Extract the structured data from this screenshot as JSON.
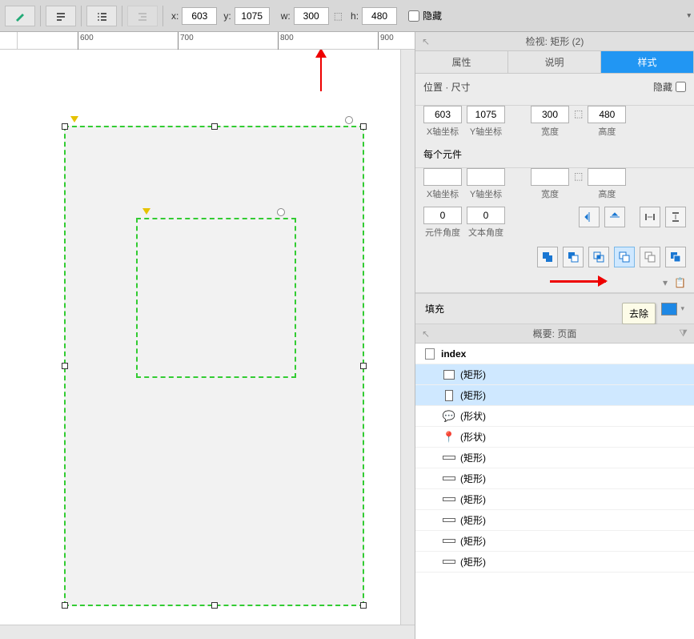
{
  "toolbar": {
    "x_label": "x:",
    "x_value": "603",
    "y_label": "y:",
    "y_value": "1075",
    "w_label": "w:",
    "w_value": "300",
    "h_label": "h:",
    "h_value": "480",
    "hide_label": "隐藏"
  },
  "ruler": {
    "ticks": [
      "600",
      "700",
      "800",
      "900"
    ]
  },
  "inspector": {
    "title": "检视: 矩形 (2)",
    "tabs": {
      "props": "属性",
      "desc": "说明",
      "style": "样式"
    },
    "pos_size": "位置 · 尺寸",
    "hide": "隐藏",
    "x": "603",
    "y": "1075",
    "w": "300",
    "h": "480",
    "x_lbl": "X轴坐标",
    "y_lbl": "Y轴坐标",
    "w_lbl": "宽度",
    "h_lbl": "高度",
    "per_elem": "每个元件",
    "per_x": "",
    "per_y": "",
    "per_w": "",
    "per_h": "",
    "angle1": "0",
    "angle2": "0",
    "angle1_lbl": "元件角度",
    "angle2_lbl": "文本角度",
    "tooltip": "去除",
    "fill": "填充"
  },
  "outline": {
    "title": "概要: 页面",
    "root": "index",
    "items": [
      {
        "icon": "rect",
        "label": "(矩形)",
        "sel": true
      },
      {
        "icon": "rectv",
        "label": "(矩形)",
        "sel": true
      },
      {
        "icon": "bubble",
        "label": "(形状)",
        "sel": false
      },
      {
        "icon": "pin",
        "label": "(形状)",
        "sel": false
      },
      {
        "icon": "bar",
        "label": "(矩形)",
        "sel": false
      },
      {
        "icon": "bar",
        "label": "(矩形)",
        "sel": false
      },
      {
        "icon": "bar",
        "label": "(矩形)",
        "sel": false
      },
      {
        "icon": "bar",
        "label": "(矩形)",
        "sel": false
      },
      {
        "icon": "bar",
        "label": "(矩形)",
        "sel": false
      },
      {
        "icon": "bar",
        "label": "(矩形)",
        "sel": false
      }
    ]
  }
}
